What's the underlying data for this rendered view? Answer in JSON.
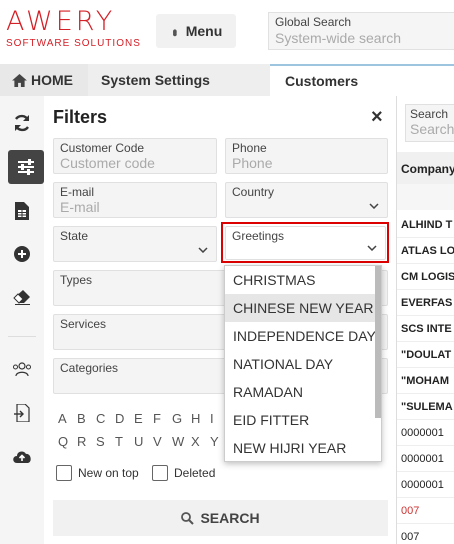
{
  "header": {
    "logo_main": "AWERY",
    "logo_sub": "SOFTWARE SOLUTIONS",
    "menu_label": "Menu",
    "search_label": "Global Search",
    "search_placeholder": "System-wide search"
  },
  "tabs": [
    {
      "label": "HOME"
    },
    {
      "label": "System Settings"
    },
    {
      "label": "Customers"
    }
  ],
  "filters": {
    "title": "Filters",
    "customer_code": {
      "label": "Customer Code",
      "placeholder": "Customer code"
    },
    "phone": {
      "label": "Phone",
      "placeholder": "Phone"
    },
    "email": {
      "label": "E-mail",
      "placeholder": "E-mail"
    },
    "country": {
      "label": "Country"
    },
    "state": {
      "label": "State"
    },
    "greetings": {
      "label": "Greetings"
    },
    "types": {
      "label": "Types"
    },
    "services": {
      "label": "Services"
    },
    "categories": {
      "label": "Categories"
    },
    "letters_row1": [
      "A",
      "B",
      "C",
      "D",
      "E",
      "F",
      "G",
      "H",
      "I"
    ],
    "letters_row2": [
      "Q",
      "R",
      "S",
      "T",
      "U",
      "V",
      "W",
      "X",
      "Y"
    ],
    "new_on_top": "New on top",
    "deleted": "Deleted",
    "search_button": "SEARCH"
  },
  "greetings_dropdown": {
    "options": [
      "CHRISTMAS",
      "CHINESE NEW YEAR",
      "INDEPENDENCE DAY",
      "NATIONAL DAY",
      "RAMADAN",
      "EID FITTER",
      "NEW HIJRI YEAR"
    ],
    "hovered": "CHINESE NEW YEAR"
  },
  "table": {
    "search_label": "Search",
    "search_placeholder": "Search...",
    "column": "Company",
    "rows": [
      "ALHIND T",
      "ATLAS LO",
      "CM LOGIS",
      "EVERFAS",
      "SCS INTE",
      "\"DOULAT",
      "\"MOHAM",
      "\"SULEMA",
      "0000001",
      "0000001",
      "0000001",
      "007",
      "007"
    ]
  },
  "colors": {
    "brand": "#d42027",
    "highlight": "#dd0000"
  }
}
